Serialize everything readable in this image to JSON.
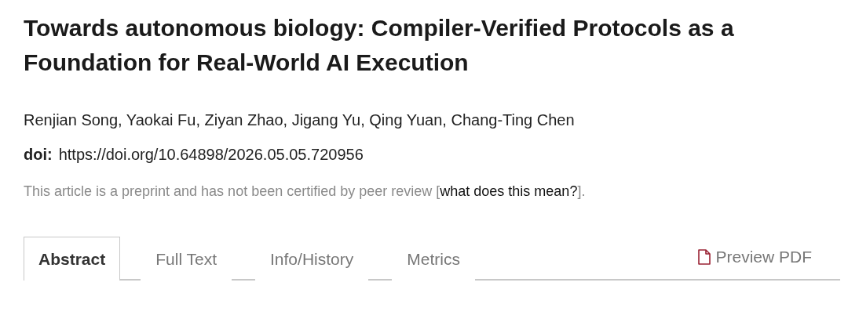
{
  "title": "Towards autonomous biology: Compiler-Verified Protocols as a Foundation for Real-World AI Execution",
  "authors": "Renjian Song, Yaokai Fu, Ziyan Zhao, Jigang Yu, Qing Yuan, Chang-Ting Chen",
  "doi": {
    "label": "doi:",
    "value": "https://doi.org/10.64898/2026.05.05.720956"
  },
  "notice": {
    "before": "This article is a preprint and has not been certified by peer review [",
    "link": "what does this mean?",
    "after": "]."
  },
  "tabs": [
    {
      "label": "Abstract",
      "selected": true
    },
    {
      "label": "Full Text",
      "selected": false
    },
    {
      "label": "Info/History",
      "selected": false
    },
    {
      "label": "Metrics",
      "selected": false
    }
  ],
  "preview_pdf": "Preview PDF"
}
